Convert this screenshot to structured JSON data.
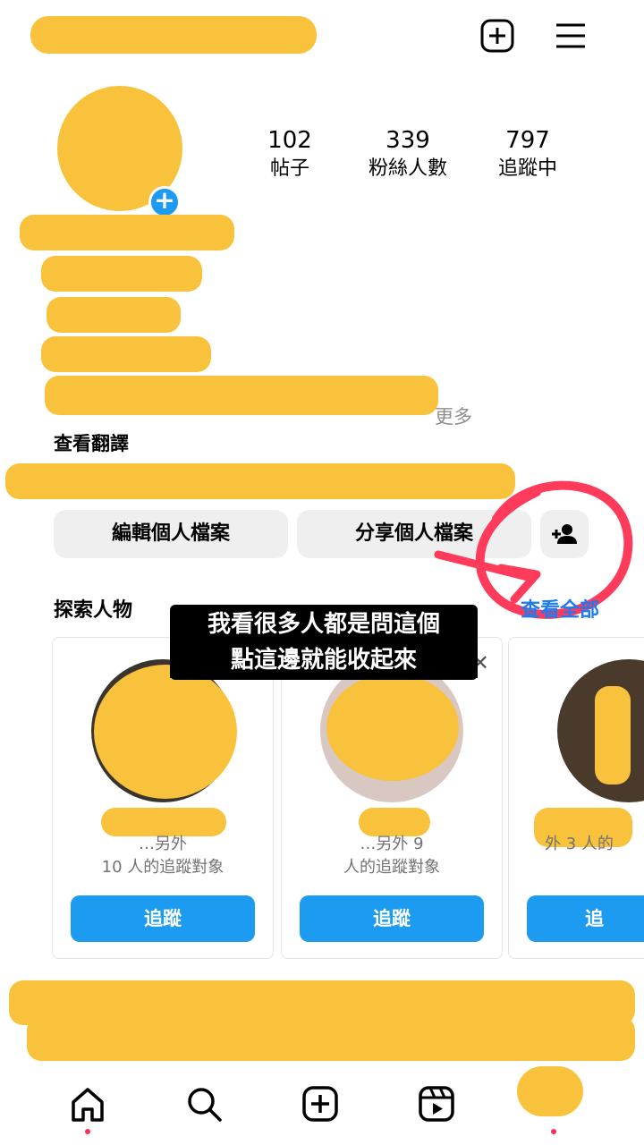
{
  "stats": [
    {
      "value": "102",
      "label": "帖子"
    },
    {
      "value": "339",
      "label": "粉絲人數"
    },
    {
      "value": "797",
      "label": "追蹤中"
    }
  ],
  "profile": {
    "more_label": "更多",
    "translate_label": "查看翻譯"
  },
  "actions": {
    "edit_profile": "編輯個人檔案",
    "share_profile": "分享個人檔案"
  },
  "explore": {
    "title": "探索人物",
    "see_all": "查看全部",
    "cards": [
      {
        "sub_line1": "…另外",
        "sub_line2": "10 人的追蹤對象",
        "follow": "追蹤"
      },
      {
        "sub_line1": "…另外 9",
        "sub_line2": "人的追蹤對象",
        "follow": "追蹤"
      },
      {
        "sub_line1": "",
        "sub_line2": "外 3 人的",
        "follow": "追"
      }
    ]
  },
  "annotation": {
    "line1": "我看很多人都是問這個",
    "line2": "點這邊就能收起來"
  },
  "icons": {
    "new_post": "plus-square-icon",
    "menu": "hamburger-menu-icon",
    "add_person": "person-add-icon",
    "close": "close-icon",
    "home": "home-icon",
    "search": "search-icon",
    "create": "create-icon",
    "reels": "reels-icon",
    "profile": "profile-icon"
  },
  "colors": {
    "accent": "#1d9bf0",
    "redaction": "#f9c23c",
    "annotation_circle": "#ff3b5c"
  }
}
